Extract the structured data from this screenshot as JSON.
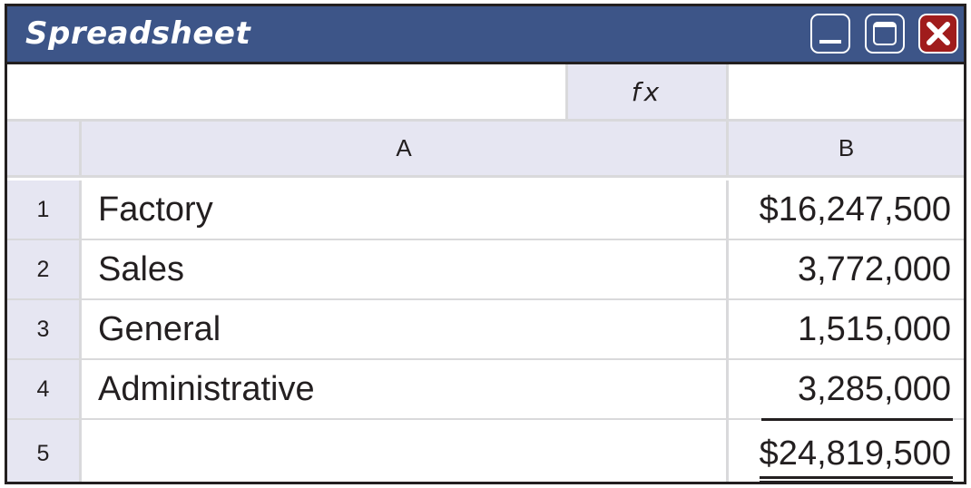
{
  "window": {
    "title": "Spreadsheet",
    "buttons": {
      "minimize": "minimize-icon",
      "maximize": "maximize-icon",
      "close": "close-icon"
    }
  },
  "formula_bar": {
    "name_box": "",
    "fx_label": "fx",
    "formula": ""
  },
  "columns": [
    "A",
    "B"
  ],
  "rows": [
    {
      "num": "1",
      "a": "Factory",
      "b": "$16,247,500"
    },
    {
      "num": "2",
      "a": "Sales",
      "b": "3,772,000"
    },
    {
      "num": "3",
      "a": "General",
      "b": "1,515,000"
    },
    {
      "num": "4",
      "a": "Administrative",
      "b": "3,285,000"
    },
    {
      "num": "5",
      "a": "",
      "b": "$24,819,500"
    }
  ],
  "colors": {
    "titlebar": "#3d5588",
    "header_fill": "#e6e6f2",
    "close_button": "#a01c1c"
  }
}
